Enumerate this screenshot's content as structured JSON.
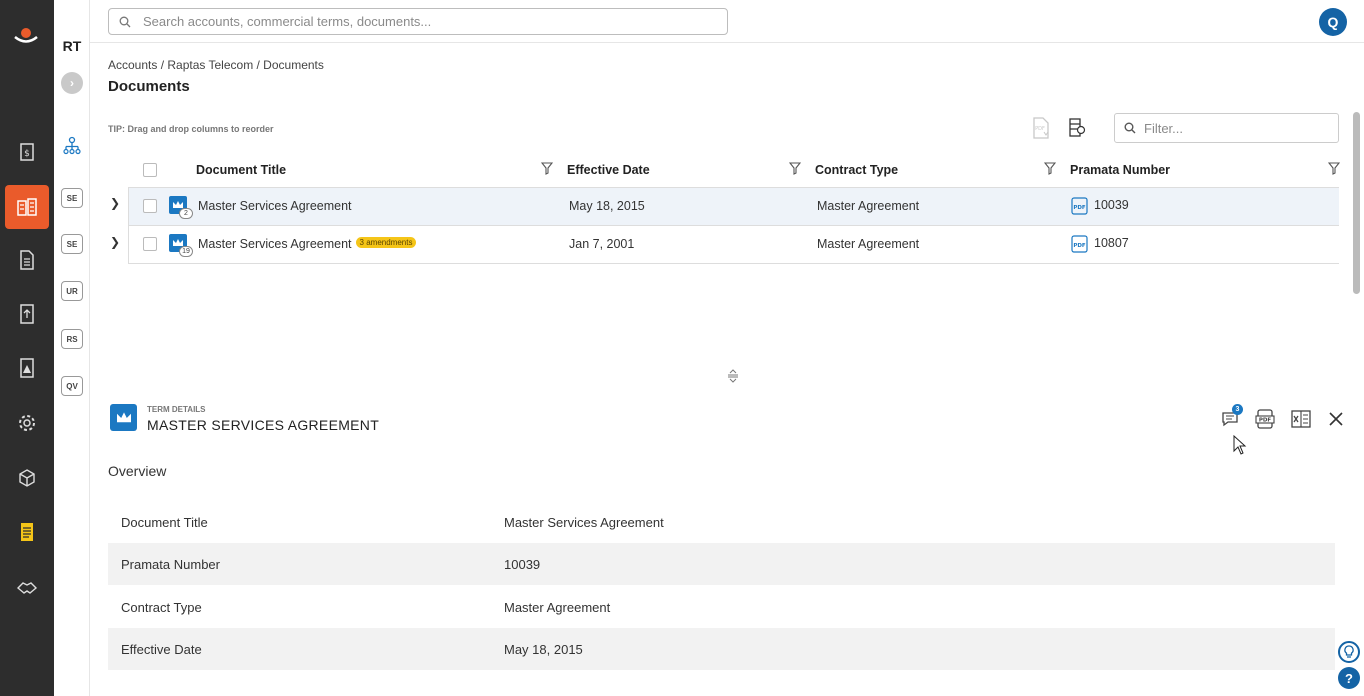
{
  "colors": {
    "nav_bg": "#2d2d2d",
    "nav_active": "#ea5b2b",
    "accent": "#1463a5",
    "crown": "#1b78c2",
    "amendment_badge": "#f5c518"
  },
  "nav": {
    "items": [
      {
        "icon": "contract-dollar-icon"
      },
      {
        "icon": "accounts-building-icon",
        "active": true
      },
      {
        "icon": "document-icon"
      },
      {
        "icon": "upload-document-icon"
      },
      {
        "icon": "report-icon"
      },
      {
        "icon": "settings-gear-icon"
      },
      {
        "icon": "package-box-icon"
      },
      {
        "icon": "documents-yellow-icon"
      },
      {
        "icon": "handshake-icon"
      }
    ]
  },
  "account_panel": {
    "initials": "RT",
    "chips": [
      "SE",
      "SE",
      "UR",
      "RS",
      "QV"
    ]
  },
  "topbar": {
    "search_placeholder": "Search accounts, commercial terms, documents...",
    "avatar_initial": "Q"
  },
  "breadcrumb": "Accounts / Raptas Telecom / Documents",
  "page_title": "Documents",
  "tip": "TIP: Drag and drop columns to reorder",
  "filter_placeholder": "Filter...",
  "grid": {
    "columns": [
      "Document Title",
      "Effective Date",
      "Contract Type",
      "Pramata Number"
    ],
    "rows": [
      {
        "title": "Master Services Agreement",
        "count": "2",
        "amendments": "",
        "effective_date": "May 18, 2015",
        "contract_type": "Master Agreement",
        "pramata_number": "10039",
        "selected": true
      },
      {
        "title": "Master Services Agreement",
        "count": "19",
        "amendments": "3 amendments",
        "effective_date": "Jan 7, 2001",
        "contract_type": "Master Agreement",
        "pramata_number": "10807",
        "selected": false
      }
    ]
  },
  "term_details": {
    "kicker": "TERM DETAILS",
    "title": "MASTER SERVICES AGREEMENT",
    "comment_count": "3",
    "overview_label": "Overview",
    "fields": [
      {
        "label": "Document Title",
        "value": "Master Services Agreement"
      },
      {
        "label": "Pramata Number",
        "value": "10039"
      },
      {
        "label": "Contract Type",
        "value": "Master Agreement"
      },
      {
        "label": "Effective Date",
        "value": "May 18, 2015"
      }
    ]
  },
  "help": {
    "label": "?"
  }
}
